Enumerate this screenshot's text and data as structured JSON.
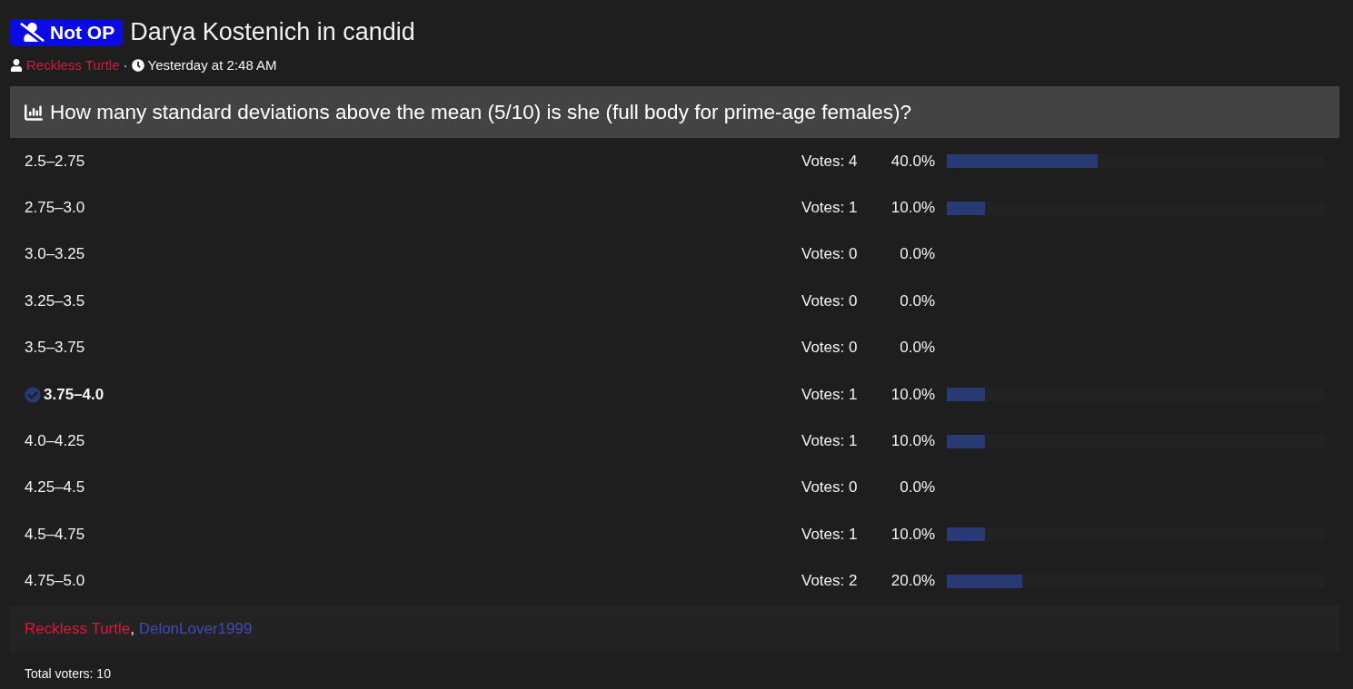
{
  "thread": {
    "badge": "Not OP",
    "title": "Darya Kostenich in candid",
    "author": "Reckless Turtle",
    "separator": "·",
    "time": "Yesterday at 2:48 AM"
  },
  "poll": {
    "question": "How many standard deviations above the mean (5/10) is she (full body for prime-age females)?",
    "options": [
      {
        "label": "2.5–2.75",
        "selected": false,
        "votes": "Votes: 4",
        "percent": "40.0%",
        "level": 0.4
      },
      {
        "label": "2.75–3.0",
        "selected": false,
        "votes": "Votes: 1",
        "percent": "10.0%",
        "level": 0.1
      },
      {
        "label": "3.0–3.25",
        "selected": false,
        "votes": "Votes: 0",
        "percent": "0.0%"
      },
      {
        "label": "3.25–3.5",
        "selected": false,
        "votes": "Votes: 0",
        "percent": "0.0%"
      },
      {
        "label": "3.5–3.75",
        "selected": false,
        "votes": "Votes: 0",
        "percent": "0.0%"
      },
      {
        "label": "3.75–4.0",
        "selected": true,
        "votes": "Votes: 1",
        "percent": "10.0%",
        "level": 0.1
      },
      {
        "label": "4.0–4.25",
        "selected": false,
        "votes": "Votes: 1",
        "percent": "10.0%",
        "level": 0.1
      },
      {
        "label": "4.25–4.5",
        "selected": false,
        "votes": "Votes: 0",
        "percent": "0.0%"
      },
      {
        "label": "4.5–4.75",
        "selected": false,
        "votes": "Votes: 1",
        "percent": "10.0%",
        "level": 0.1
      },
      {
        "label": "4.75–5.0",
        "selected": false,
        "votes": "Votes: 2",
        "percent": "20.0%",
        "level": 0.2
      }
    ],
    "voters": [
      {
        "name": "Reckless Turtle",
        "color": "#e0143c"
      },
      {
        "name": "DelonLover1999",
        "color": "#3f4ab8"
      }
    ],
    "voter_separator": ",",
    "total": "Total voters: 10"
  }
}
